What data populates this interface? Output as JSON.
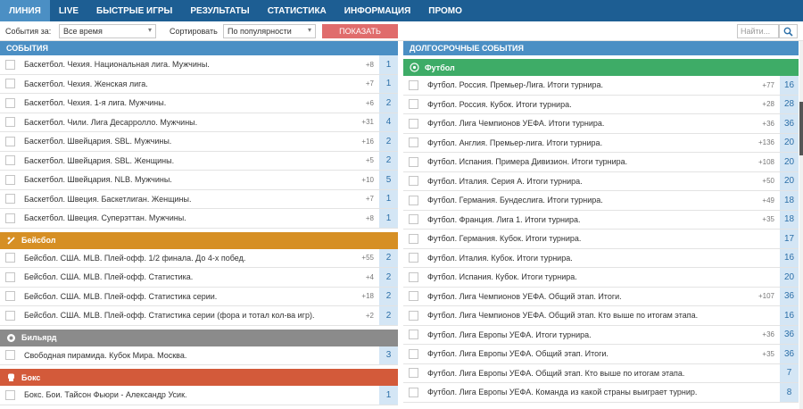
{
  "nav": {
    "items": [
      {
        "label": "ЛИНИЯ",
        "active": true
      },
      {
        "label": "LIVE",
        "active": false
      },
      {
        "label": "БЫСТРЫЕ ИГРЫ",
        "active": false
      },
      {
        "label": "РЕЗУЛЬТАТЫ",
        "active": false
      },
      {
        "label": "СТАТИСТИКА",
        "active": false
      },
      {
        "label": "ИНФОРМАЦИЯ",
        "active": false
      },
      {
        "label": "ПРОМО",
        "active": false
      }
    ]
  },
  "filter": {
    "events_label": "События за:",
    "events_value": "Все время",
    "sort_label": "Сортировать",
    "sort_value": "По популярности",
    "show_button": "ПОКАЗАТЬ",
    "search_placeholder": "Найти..."
  },
  "left": {
    "header": "СОБЫТИЯ",
    "groups": [
      {
        "sport": "",
        "rows": [
          {
            "title": "Баскетбол. Чехия. Национальная лига. Мужчины.",
            "plus": "+8",
            "count": "1"
          },
          {
            "title": "Баскетбол. Чехия. Женская лига.",
            "plus": "+7",
            "count": "1"
          },
          {
            "title": "Баскетбол. Чехия. 1-я лига. Мужчины.",
            "plus": "+6",
            "count": "2"
          },
          {
            "title": "Баскетбол. Чили. Лига Десарролло. Мужчины.",
            "plus": "+31",
            "count": "4"
          },
          {
            "title": "Баскетбол. Швейцария. SBL. Мужчины.",
            "plus": "+16",
            "count": "2"
          },
          {
            "title": "Баскетбол. Швейцария. SBL. Женщины.",
            "plus": "+5",
            "count": "2"
          },
          {
            "title": "Баскетбол. Швейцария. NLB. Мужчины.",
            "plus": "+10",
            "count": "5"
          },
          {
            "title": "Баскетбол. Швеция. Баскетлиган. Женщины.",
            "plus": "+7",
            "count": "1"
          },
          {
            "title": "Баскетбол. Швеция. Суперэттан. Мужчины.",
            "plus": "+8",
            "count": "1"
          }
        ]
      },
      {
        "sport": "Бейсбол",
        "rows": [
          {
            "title": "Бейсбол. США. MLB. Плей-офф. 1/2 финала. До 4-х побед.",
            "plus": "+55",
            "count": "2"
          },
          {
            "title": "Бейсбол. США. MLB. Плей-офф. Статистика.",
            "plus": "+4",
            "count": "2"
          },
          {
            "title": "Бейсбол. США. MLB. Плей-офф. Статистика серии.",
            "plus": "+18",
            "count": "2"
          },
          {
            "title": "Бейсбол. США. MLB. Плей-офф. Статистика серии (фора и тотал кол-ва игр).",
            "plus": "+2",
            "count": "2"
          }
        ]
      },
      {
        "sport": "Бильярд",
        "rows": [
          {
            "title": "Свободная пирамида. Кубок Мира. Москва.",
            "plus": "",
            "count": "3"
          }
        ]
      },
      {
        "sport": "Бокс",
        "rows": [
          {
            "title": "Бокс. Бои. Тайсон Фьюри - Александр Усик.",
            "plus": "",
            "count": "1"
          }
        ]
      }
    ]
  },
  "right": {
    "header": "ДОЛГОСРОЧНЫЕ СОБЫТИЯ",
    "sport": "Футбол",
    "rows": [
      {
        "title": "Футбол. Россия. Премьер-Лига. Итоги турнира.",
        "plus": "+77",
        "count": "16"
      },
      {
        "title": "Футбол. Россия. Кубок. Итоги турнира.",
        "plus": "+28",
        "count": "28"
      },
      {
        "title": "Футбол. Лига Чемпионов УЕФА. Итоги турнира.",
        "plus": "+36",
        "count": "36"
      },
      {
        "title": "Футбол. Англия. Премьер-лига. Итоги турнира.",
        "plus": "+136",
        "count": "20"
      },
      {
        "title": "Футбол. Испания. Примера Дивизион. Итоги турнира.",
        "plus": "+108",
        "count": "20"
      },
      {
        "title": "Футбол. Италия. Серия А. Итоги турнира.",
        "plus": "+50",
        "count": "20"
      },
      {
        "title": "Футбол. Германия. Бундеслига. Итоги турнира.",
        "plus": "+49",
        "count": "18"
      },
      {
        "title": "Футбол. Франция. Лига 1. Итоги турнира.",
        "plus": "+35",
        "count": "18"
      },
      {
        "title": "Футбол. Германия. Кубок. Итоги турнира.",
        "plus": "",
        "count": "17"
      },
      {
        "title": "Футбол. Италия. Кубок. Итоги турнира.",
        "plus": "",
        "count": "16"
      },
      {
        "title": "Футбол. Испания. Кубок. Итоги турнира.",
        "plus": "",
        "count": "20"
      },
      {
        "title": "Футбол. Лига Чемпионов УЕФА. Общий этап. Итоги.",
        "plus": "+107",
        "count": "36"
      },
      {
        "title": "Футбол. Лига Чемпионов УЕФА. Общий этап. Кто выше по итогам этапа.",
        "plus": "",
        "count": "16"
      },
      {
        "title": "Футбол. Лига Европы УЕФА. Итоги турнира.",
        "plus": "+36",
        "count": "36"
      },
      {
        "title": "Футбол. Лига Европы УЕФА. Общий этап. Итоги.",
        "plus": "+35",
        "count": "36"
      },
      {
        "title": "Футбол. Лига Европы УЕФА. Общий этап. Кто выше по итогам этапа.",
        "plus": "",
        "count": "7"
      },
      {
        "title": "Футбол. Лига Европы УЕФА. Команда из какой страны выиграет турнир.",
        "plus": "",
        "count": "8"
      }
    ]
  }
}
